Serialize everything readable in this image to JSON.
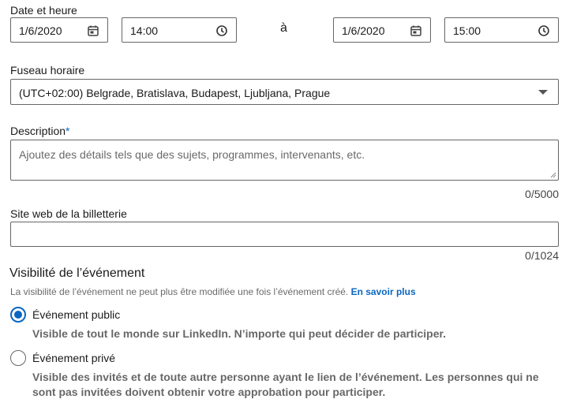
{
  "datetime": {
    "label": "Date et heure",
    "start_date": "1/6/2020",
    "start_time": "14:00",
    "separator": "à",
    "end_date": "1/6/2020",
    "end_time": "15:00"
  },
  "timezone": {
    "label": "Fuseau horaire",
    "value": "(UTC+02:00) Belgrade, Bratislava, Budapest, Ljubljana, Prague"
  },
  "description": {
    "label": "Description",
    "required_mark": "*",
    "placeholder": "Ajoutez des détails tels que des sujets, programmes, intervenants, etc.",
    "counter": "0/5000"
  },
  "ticket_site": {
    "label": "Site web de la billetterie",
    "value": "",
    "counter": "0/1024"
  },
  "visibility": {
    "title": "Visibilité de l’événement",
    "note": "La visibilité de l’événement ne peut plus être modifiée une fois l’événement créé.",
    "learn_more": "En savoir plus",
    "options": [
      {
        "label": "Événement public",
        "description": "Visible de tout le monde sur LinkedIn. N’importe qui peut décider de participer.",
        "selected": true
      },
      {
        "label": "Événement privé",
        "description_line1": "Visible des invités et de toute autre personne ayant le lien de l’événement. Les personnes qui ne",
        "description_line2": "sont pas invitées doivent obtenir votre approbation pour participer.",
        "selected": false
      }
    ]
  },
  "icons": {
    "calendar": "calendar-icon",
    "clock": "clock-icon",
    "dropdown": "caret-down-icon"
  },
  "colors": {
    "accent": "#0a66c2",
    "border": "#666666"
  }
}
